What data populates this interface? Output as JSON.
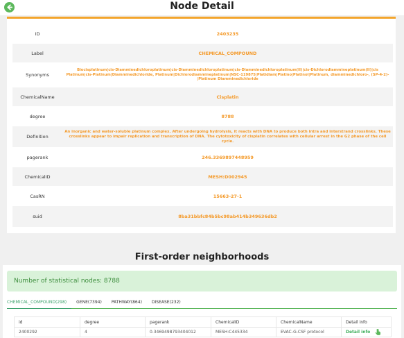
{
  "header": {
    "title": "Node Detail"
  },
  "details": [
    {
      "label": "ID",
      "value": "2403235"
    },
    {
      "label": "Label",
      "value": "CHEMICAL_COMPOUND"
    },
    {
      "label": "Synonyms",
      "value": "Biocisplatinum|cis-Diamminedichloroplatinum|cis-Diamminedichloroplatinum|cis-Diamminedichloroplatinum(II)|cis-Dichlorodiammineplatinum(II)|cis Platinum|cis-Platinum|Diamminedichloride, Platinum|Dichlorodiammineplatinum|NSC-119875|Platidiam|Platino|Platinol|Platinum, diamminedichloro-, (SP-4-2)-|Platinum Diamminedichloride"
    },
    {
      "label": "ChemicalName",
      "value": "Cisplatin"
    },
    {
      "label": "degree",
      "value": "8788"
    },
    {
      "label": "Definition",
      "value": "An inorganic and water-soluble platinum complex. After undergoing hydrolysis, it reacts with DNA to produce both intra and interstrand crosslinks. These crosslinks appear to impair replication and transcription of DNA. The cytotoxicity of cisplatin correlates with cellular arrest in the G2 phase of the cell cycle."
    },
    {
      "label": "pagerank",
      "value": "246.3369897448959"
    },
    {
      "label": "ChemicalID",
      "value": "MESH:D002945"
    },
    {
      "label": "CasRN",
      "value": "15663-27-1"
    },
    {
      "label": "suid",
      "value": "8ba31bbfc84b5bc98ab414b349636db2"
    }
  ],
  "neighborhoods": {
    "title": "First-order neighborhoods",
    "stat_text": "Number of statistical nodes: 8788",
    "tabs": [
      "CHEMICAL_COMPOUND(298)",
      "GENE(7394)",
      "PATHWAY(864)",
      "DISEASE(232)"
    ],
    "active_tab": 0,
    "columns": [
      "id",
      "degree",
      "pagerank",
      "ChemicalID",
      "ChemicalName",
      "Detail info"
    ],
    "rows": [
      [
        "2400292",
        "4",
        "0.3469498793404012",
        "MESH:C445334",
        "EVAC-G-CSF protocol",
        "Detail info"
      ]
    ]
  },
  "icons": {
    "back": "arrow-left-icon",
    "detail": "pointing-hand-icon"
  },
  "colors": {
    "accent": "#f49a2a",
    "green": "#5cb85c",
    "stat_bg": "#d9f2d9",
    "stat_text": "#3c8d3c"
  }
}
